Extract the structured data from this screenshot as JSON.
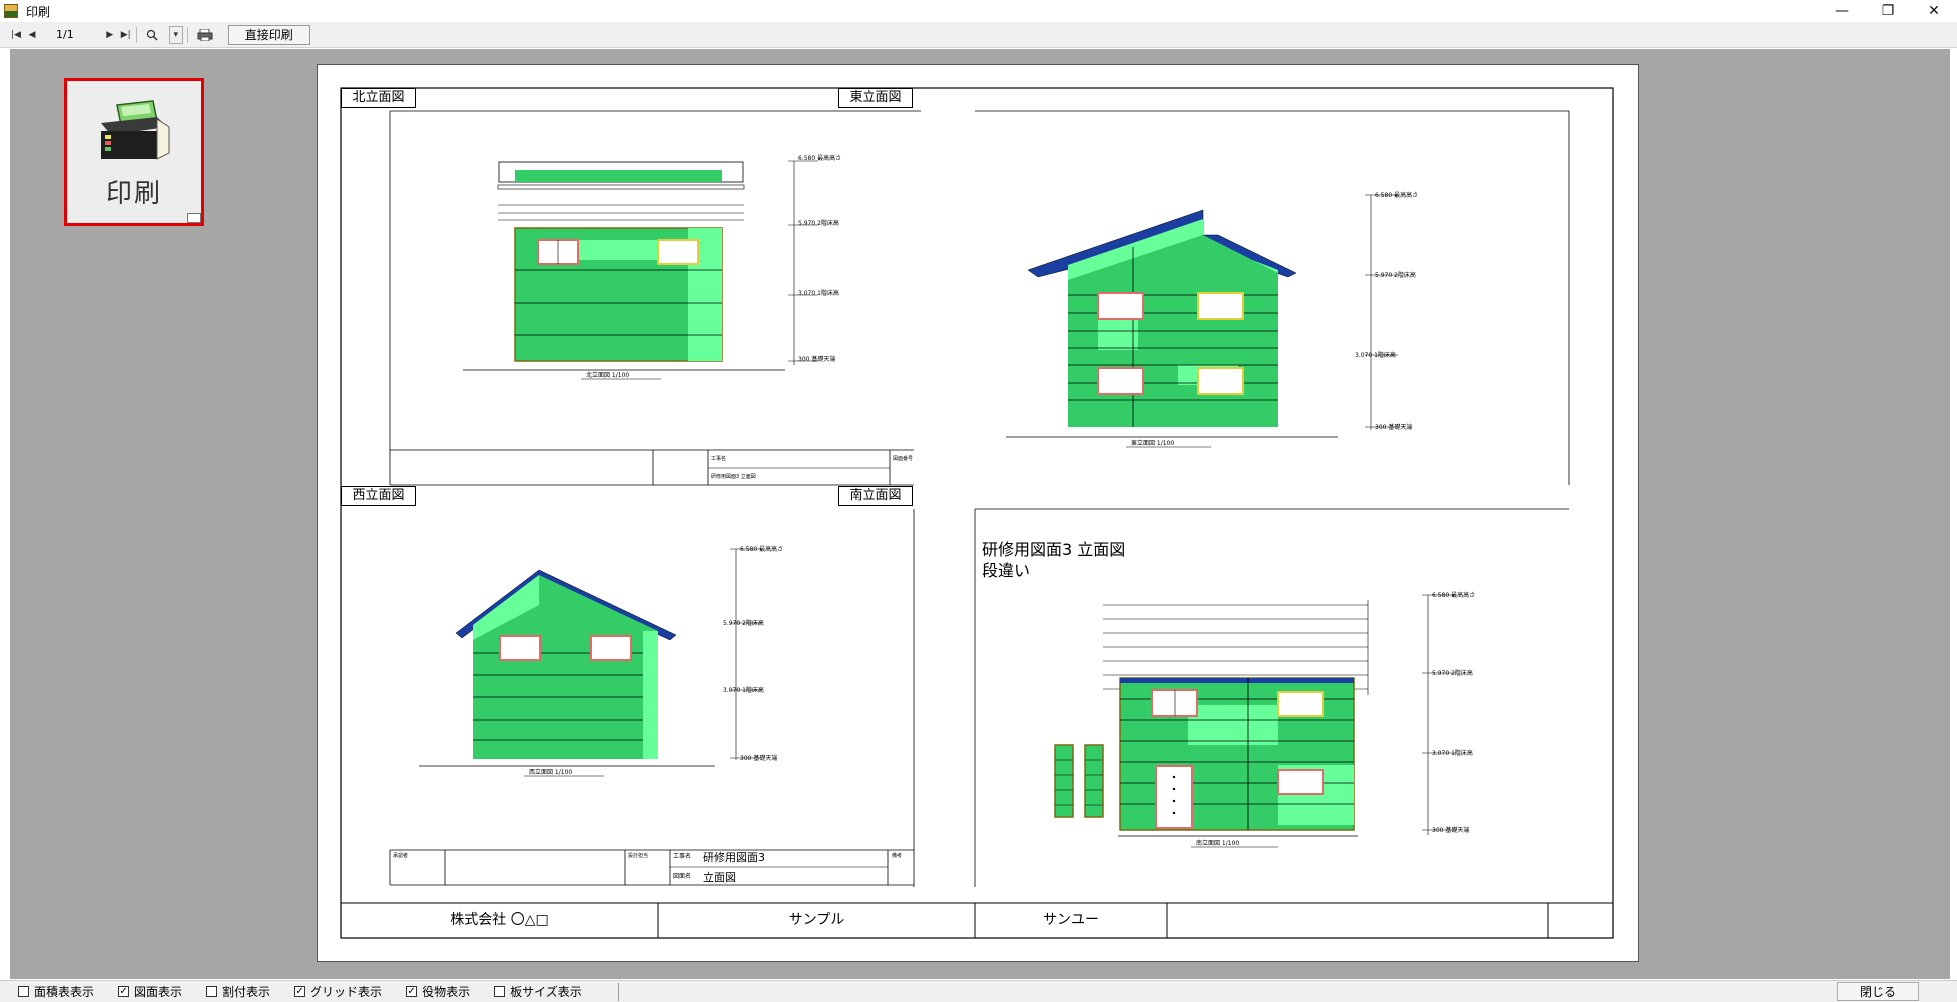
{
  "window": {
    "title": "印刷",
    "minimize_glyph": "—",
    "maximize_glyph": "❐",
    "close_glyph": "✕"
  },
  "toolbar": {
    "page_indicator": "1/1",
    "direct_print_label": "直接印刷"
  },
  "print_button": {
    "label": "印刷",
    "icon": "printer-icon"
  },
  "sheet": {
    "panels": [
      {
        "label": "北立面図"
      },
      {
        "label": "東立面図"
      },
      {
        "label": "西立面図"
      },
      {
        "label": "南立面図"
      }
    ],
    "drawing_title_line1": "研修用図面3 立面図",
    "drawing_title_line2": "段違い",
    "title_block": {
      "project_label": "工事名",
      "project_value": "研修用図面3",
      "drawing_label": "図面名",
      "drawing_value": "立面図"
    },
    "footer": {
      "company": "株式会社 〇△□",
      "sample": "サンプル",
      "maker": "サンユー"
    }
  },
  "statusbar": {
    "checkboxes": [
      {
        "label": "面積表表示",
        "checked": false
      },
      {
        "label": "図面表示",
        "checked": true
      },
      {
        "label": "割付表示",
        "checked": false
      },
      {
        "label": "グリッド表示",
        "checked": true
      },
      {
        "label": "役物表示",
        "checked": true
      },
      {
        "label": "板サイズ表示",
        "checked": false
      }
    ],
    "close_label": "閉じる"
  },
  "colors": {
    "wall_green": "#33cc66",
    "wall_light": "#66ff99",
    "highlight_red": "#e00000",
    "background_gray": "#a6a6a6"
  }
}
